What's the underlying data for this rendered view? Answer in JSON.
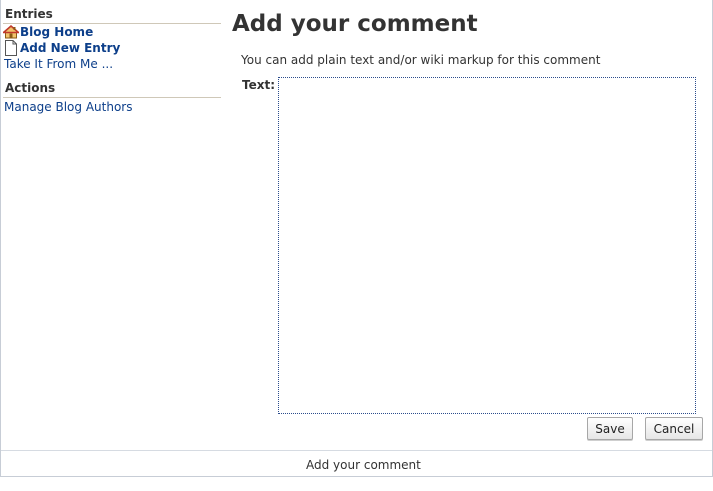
{
  "sidebar": {
    "entries_heading": "Entries",
    "entries": [
      {
        "label": "Blog Home",
        "icon": "home-icon"
      },
      {
        "label": "Add New Entry",
        "icon": "page-icon"
      },
      {
        "label": "Take It From Me ..."
      }
    ],
    "actions_heading": "Actions",
    "actions": [
      {
        "label": "Manage Blog Authors"
      }
    ]
  },
  "main": {
    "title": "Add your comment",
    "hint": "You can add plain text and/or wiki markup for this comment",
    "text_label": "Text:",
    "text_value": "",
    "save_label": "Save",
    "cancel_label": "Cancel"
  },
  "footer": {
    "text": "Add your comment"
  },
  "colors": {
    "link": "#0d3f8a",
    "text": "#333333",
    "border": "#c7cdd6"
  }
}
